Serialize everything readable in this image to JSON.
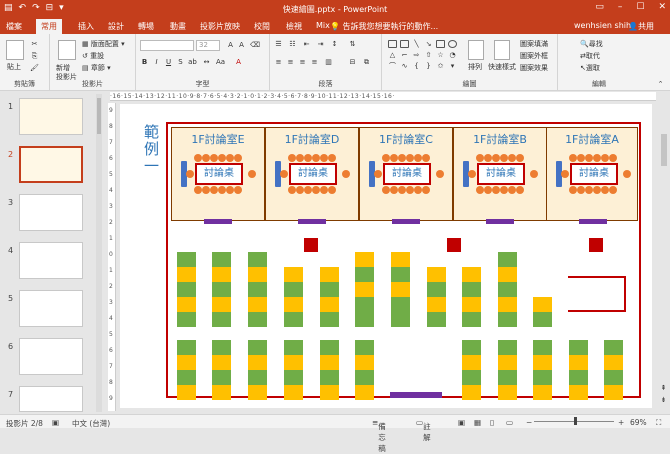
{
  "titlebar": {
    "title": "快速繪圖.pptx - PowerPoint",
    "user": "wenhsien shih",
    "share": "共用"
  },
  "tabs": [
    "檔案",
    "常用",
    "插入",
    "設計",
    "轉場",
    "動畫",
    "投影片放映",
    "校閱",
    "檢視",
    "Mix"
  ],
  "active_tab": "常用",
  "tell_me": "告訴我您想要執行的動作...",
  "ribbon": {
    "groups": [
      "剪貼簿",
      "投影片",
      "字型",
      "段落",
      "繪圖",
      "編輯"
    ],
    "paste": "貼上",
    "new_slide": "新增\n投影片",
    "layout": "版面配置",
    "reset": "重設",
    "section": "章節",
    "font_size": "32",
    "arrange": "排列",
    "quick_styles": "快速樣式",
    "shape_fill": "圖案填滿",
    "shape_outline": "圖案外框",
    "shape_effects": "圖案效果",
    "find": "尋找",
    "replace": "取代",
    "select": "選取"
  },
  "ruler_h": "·16·15·14·13·12·11·10·9·8·7·6·5·4·3·2·1·0·1·2·3·4·5·6·7·8·9·10·11·12·13·14·15·16·",
  "ruler_v": [
    "9",
    "8",
    "7",
    "6",
    "5",
    "4",
    "3",
    "2",
    "1",
    "0",
    "1",
    "2",
    "3",
    "4",
    "5",
    "6",
    "7",
    "8",
    "9"
  ],
  "thumbnails": [
    "1",
    "2",
    "3",
    "4",
    "5",
    "6",
    "7"
  ],
  "slide": {
    "legend": "範例一",
    "rooms": [
      "1F討論室E",
      "1F討論室D",
      "1F討論室C",
      "1F討論室B",
      "1F討論室A"
    ],
    "table_label": "討論桌",
    "colors": {
      "accent": "#c43e1c",
      "frame": "#c00000",
      "room_bg": "#fdf0d6",
      "green": "#70ad47",
      "yellow": "#ffc000",
      "blue": "#4472c4",
      "purple": "#7030a0",
      "orange": "#ed7d31",
      "title_blue": "#2e75b6"
    }
  },
  "status": {
    "slide": "投影片 2/8",
    "lang": "中文 (台灣)",
    "notes": "備忘稿",
    "comments": "註解",
    "zoom": "69%"
  }
}
